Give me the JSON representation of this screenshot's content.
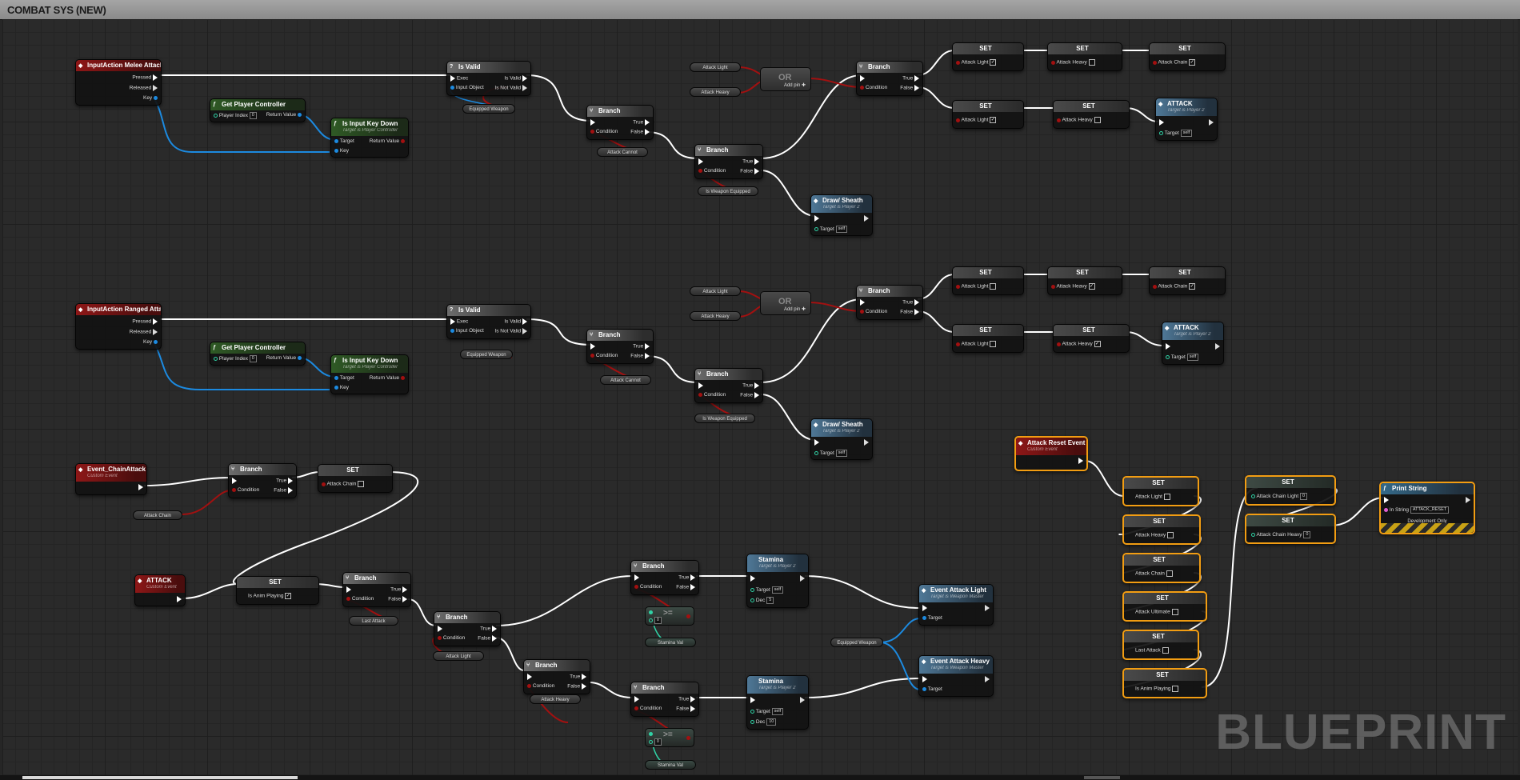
{
  "window": {
    "title": "COMBAT SYS (NEW)"
  },
  "watermark": "BLUEPRINT",
  "pins": {
    "pressed": "Pressed",
    "released": "Released",
    "key": "Key",
    "exec": "Exec",
    "is_valid": "Is Valid",
    "is_not_valid": "Is Not Valid",
    "input_object": "Input Object",
    "true": "True",
    "false": "False",
    "condition": "Condition",
    "target": "Target",
    "return_value": "Return Value",
    "player_index": "Player Index",
    "add_pin": "Add pin",
    "dec": "Dec",
    "in_string": "In String",
    "self": "self"
  },
  "nodes": {
    "melee_event": {
      "title": "InputAction Melee Attack"
    },
    "ranged_event": {
      "title": "InputAction Ranged Attack"
    },
    "get_player_controller": {
      "title": "Get Player Controller",
      "index": "0"
    },
    "is_input_key_down": {
      "title": "Is Input Key Down",
      "subtitle": "Target is Player Controller"
    },
    "is_valid": {
      "title": "Is Valid"
    },
    "branch": {
      "title": "Branch"
    },
    "or": {
      "title": "OR"
    },
    "set": {
      "title": "SET"
    },
    "attack": {
      "title": "ATTACK",
      "subtitle": "Target is Player 2"
    },
    "draw_sheath": {
      "title": "Draw/ Sheath",
      "subtitle": "Target is Player 2"
    },
    "event_chain_attack": {
      "title": "Event_ChainAttack",
      "subtitle": "Custom Event"
    },
    "attack_custom": {
      "title": "ATTACK",
      "subtitle": "Custom Event"
    },
    "stamina": {
      "title": "Stamina",
      "subtitle": "Target is Player 2",
      "dec_light": "5",
      "dec_heavy": "10"
    },
    "compare": {
      "op": ">=",
      "value": "0"
    },
    "event_attack_light": {
      "title": "Event Attack Light",
      "subtitle": "Target is Weapon Master"
    },
    "event_attack_heavy": {
      "title": "Event Attack Heavy",
      "subtitle": "Target is Weapon Master"
    },
    "attack_reset_event": {
      "title": "Attack Reset Event",
      "subtitle": "Custom Event"
    },
    "print_string": {
      "title": "Print String",
      "in_string": "ATTACK_RESET",
      "dev_only": "Development Only"
    }
  },
  "variables": {
    "attack_light": "Attack Light",
    "attack_heavy": "Attack Heavy",
    "attack_chain": "Attack Chain",
    "attack_cannot": "Attack Cannot",
    "equipped_weapon": "Equipped Weapon",
    "is_weapon_equipped": "Is Weapon Equipped",
    "is_anim_playing": "Is Anim Playing",
    "last_attack": "Last Attack",
    "stamina_val": "Stamina Val",
    "attack_ultimate": "Attack Ultimate",
    "attack_chain_light": "Attack Chain Light",
    "attack_chain_heavy": "Attack Chain Heavy"
  },
  "colors": {
    "event_header": "#8e1717",
    "function_header": "#2f5a25",
    "flow_header": "#6d6d6d",
    "target_header": "#4f7897",
    "exec_wire": "#ffffff",
    "bool_wire": "#a21010",
    "object_wire": "#1c8ae0",
    "float_wire": "#30d3a6",
    "selection": "#f29d12",
    "grid_background": "#2a2a2a"
  }
}
